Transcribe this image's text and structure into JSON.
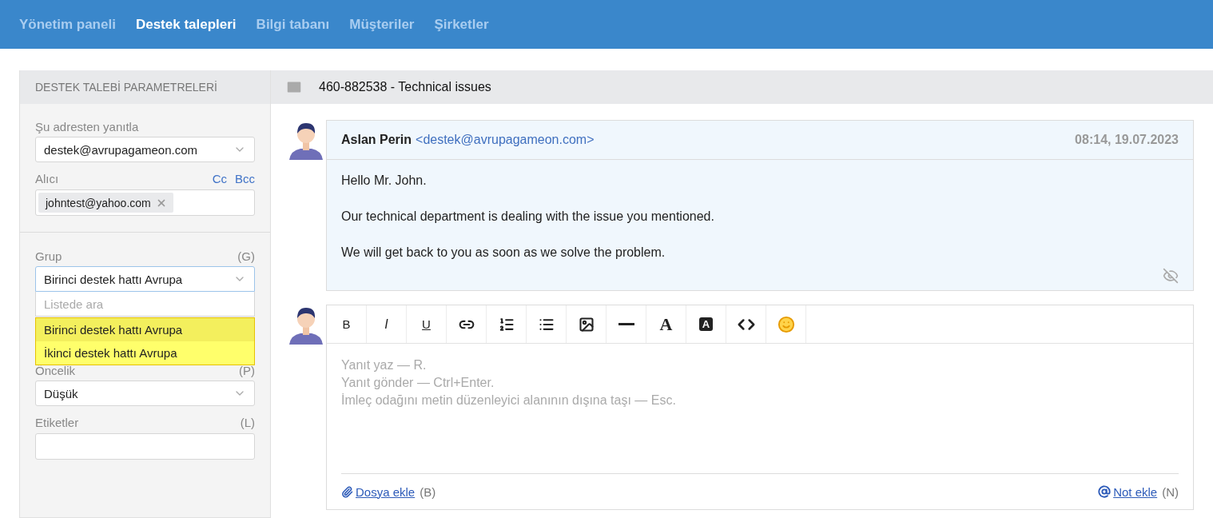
{
  "nav": [
    {
      "label": "Yönetim paneli",
      "selected": false
    },
    {
      "label": "Destek talepleri",
      "selected": true
    },
    {
      "label": "Bilgi tabanı",
      "selected": false
    },
    {
      "label": "Müşteriler",
      "selected": false
    },
    {
      "label": "Şirketler",
      "selected": false
    }
  ],
  "sidebar": {
    "title": "DESTEK TALEBİ PARAMETRELERİ",
    "reply_from": {
      "label": "Şu adresten yanıtla",
      "value": "destek@avrupagameon.com"
    },
    "recipient": {
      "label": "Alıcı",
      "links": [
        "Cc",
        "Bcc"
      ],
      "tags": [
        "johntest@yahoo.com"
      ]
    },
    "group": {
      "label": "Grup",
      "shortcut": "(G)",
      "value": "Birinci destek hattı Avrupa",
      "search_placeholder": "Listede ara",
      "options": [
        {
          "label": "Birinci destek hattı Avrupa",
          "selected": true
        },
        {
          "label": "İkinci destek hattı Avrupa",
          "selected": false
        }
      ]
    },
    "priority": {
      "label": "Öncelik",
      "shortcut": "(P)",
      "value": "Düşük"
    },
    "tags": {
      "label": "Etiketler",
      "shortcut": "(L)"
    }
  },
  "ticket": {
    "title": "460-882538 - Technical issues"
  },
  "message": {
    "sender": "Aslan Perin",
    "email": "<destek@avrupagameon.com>",
    "time": "08:14, 19.07.2023",
    "paragraphs": [
      "Hello Mr. John.",
      "Our technical department is dealing with the issue you mentioned.",
      "We will get back to you as soon as we solve the problem."
    ]
  },
  "editor": {
    "toolbar": [
      {
        "kind": "bold",
        "label": "B"
      },
      {
        "kind": "italic",
        "label": "I"
      },
      {
        "kind": "underline",
        "label": "U"
      },
      {
        "kind": "link"
      },
      {
        "kind": "ordered-list"
      },
      {
        "kind": "bullet-list"
      },
      {
        "kind": "image"
      },
      {
        "kind": "rule"
      },
      {
        "kind": "font-color",
        "label": "A"
      },
      {
        "kind": "background-color",
        "label": "A"
      },
      {
        "kind": "code"
      },
      {
        "kind": "emoji"
      }
    ],
    "placeholder_lines": [
      "Yanıt yaz — R.",
      "Yanıt gönder — Ctrl+Enter.",
      "İmleç odağını metin düzenleyici alanının dışına taşı — Esc."
    ],
    "attach": {
      "label": "Dosya ekle",
      "shortcut": "(B)"
    },
    "note": {
      "label": "Not ekle",
      "shortcut": "(N)"
    }
  }
}
